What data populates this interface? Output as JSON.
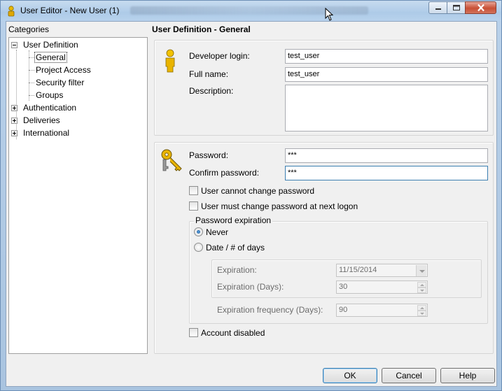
{
  "window": {
    "title": "User Editor - New User (1)"
  },
  "categories": {
    "label": "Categories",
    "tree": [
      {
        "label": "User Definition",
        "expanded": true,
        "children": [
          "General",
          "Project Access",
          "Security filter",
          "Groups"
        ]
      },
      {
        "label": "Authentication",
        "expanded": false
      },
      {
        "label": "Deliveries",
        "expanded": false
      },
      {
        "label": "International",
        "expanded": false
      }
    ],
    "selected": "General"
  },
  "section_title": "User Definition - General",
  "identity": {
    "developer_login_label": "Developer login:",
    "developer_login_value": "test_user",
    "full_name_label": "Full name:",
    "full_name_value": "test_user",
    "description_label": "Description:",
    "description_value": ""
  },
  "password": {
    "password_label": "Password:",
    "password_value": "***",
    "confirm_label": "Confirm password:",
    "confirm_value": "***",
    "cannot_change_label": "User cannot change password",
    "cannot_change_checked": false,
    "must_change_label": "User must change password at next logon",
    "must_change_checked": false,
    "expiration": {
      "legend": "Password expiration",
      "never_label": "Never",
      "date_label": "Date / # of days",
      "selected": "Never",
      "expiration_label": "Expiration:",
      "expiration_value": "11/15/2014",
      "expiration_days_label": "Expiration (Days):",
      "expiration_days_value": "30",
      "frequency_label": "Expiration frequency (Days):",
      "frequency_value": "90"
    },
    "account_disabled_label": "Account disabled",
    "account_disabled_checked": false
  },
  "buttons": {
    "ok": "OK",
    "cancel": "Cancel",
    "help": "Help"
  },
  "colors": {
    "title_bar": "#b9d1ea",
    "close_button": "#c84f35",
    "dialog_bg": "#f0f0f0",
    "focus_border": "#3c7fb1"
  },
  "icons": [
    "user-lock-icon",
    "user-icon",
    "keys-icon",
    "cursor-icon"
  ]
}
